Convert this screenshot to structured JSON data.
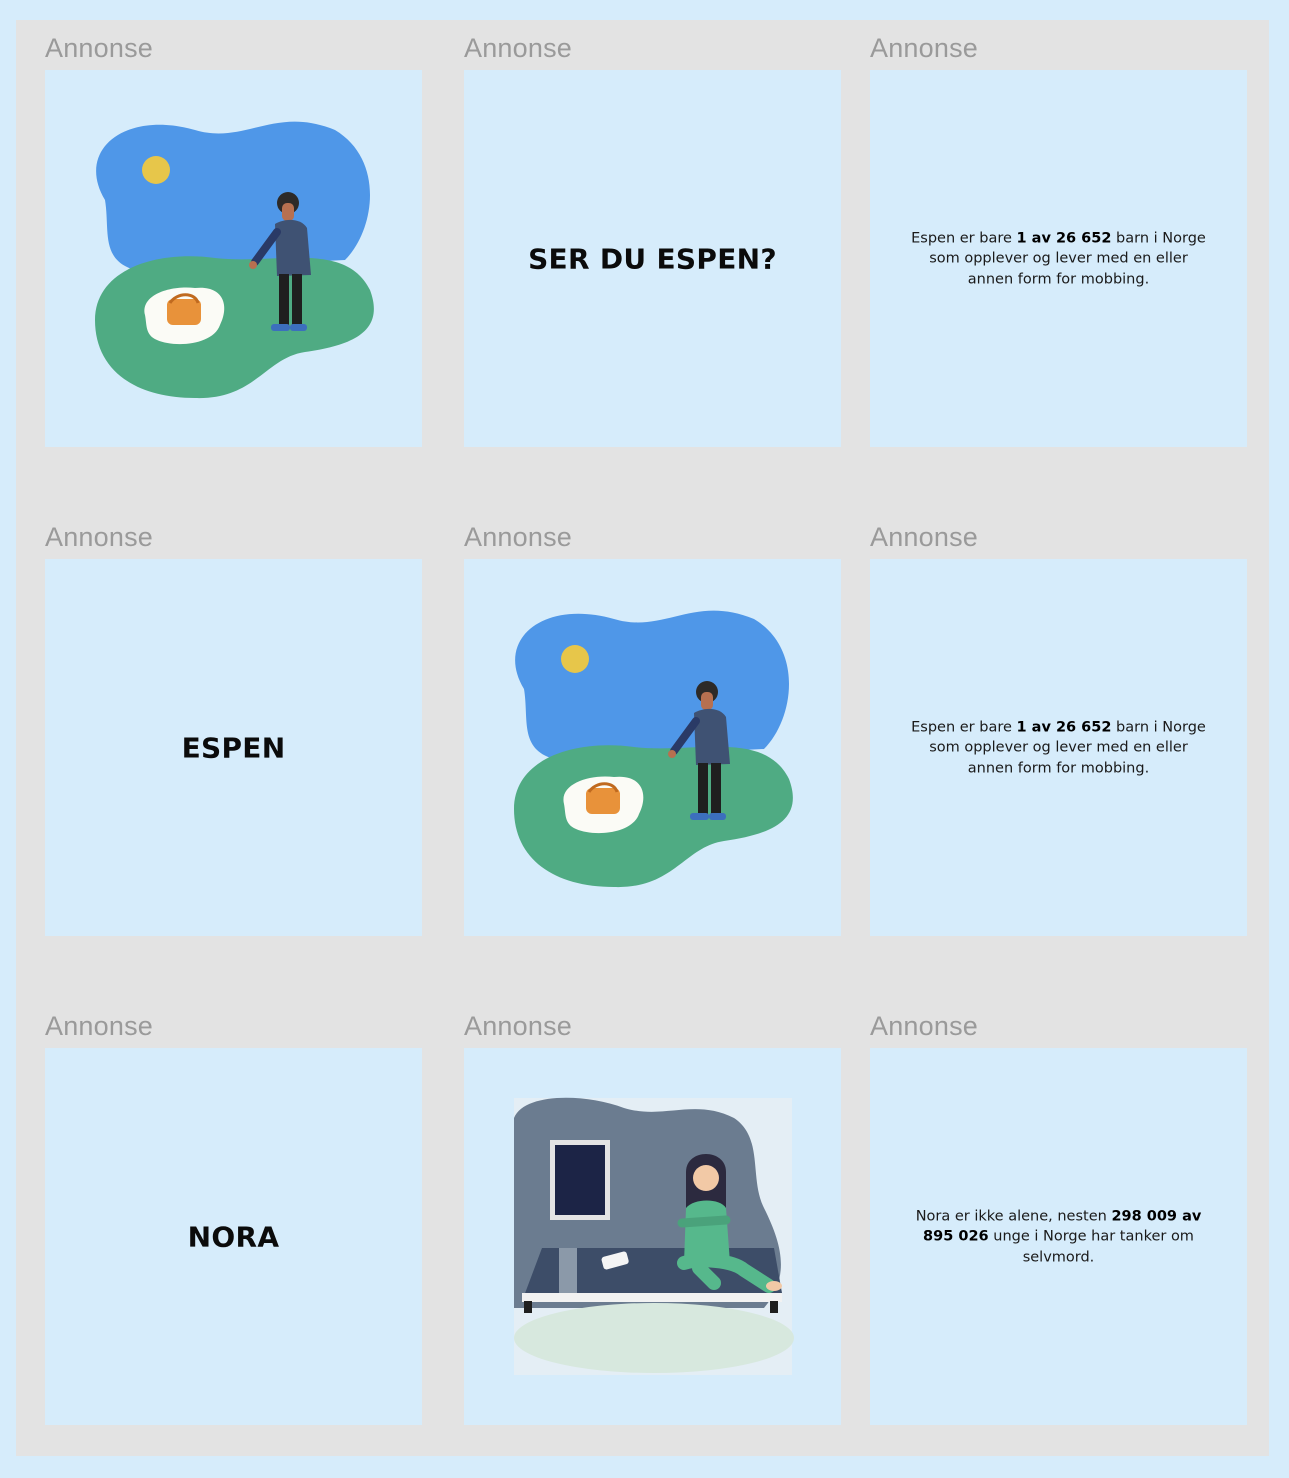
{
  "ad_label": "Annonse",
  "rows": [
    {
      "image_card": {
        "illustration": "boy-in-park-with-bag-illustration"
      },
      "headline_card": {
        "headline": "SER DU ESPEN?"
      },
      "stat_card": {
        "pre": "Espen er bare ",
        "bold": "1 av 26 652",
        "post": " barn i Norge som opplever og lever med en eller annen form for mobbing."
      }
    },
    {
      "headline_card": {
        "headline": "ESPEN"
      },
      "image_card": {
        "illustration": "boy-in-park-with-bag-illustration"
      },
      "stat_card": {
        "pre": "Espen er bare ",
        "bold": "1 av 26 652",
        "post": " barn i Norge som opplever og lever med en eller annen form for mobbing."
      }
    },
    {
      "headline_card": {
        "headline": "NORA"
      },
      "image_card": {
        "illustration": "girl-on-bed-at-night-illustration"
      },
      "stat_card": {
        "pre": "Nora er ikke alene, nesten ",
        "bold": "298 009 av 895 026",
        "post": " unge i Norge har tanker om selvmord."
      }
    }
  ],
  "colors": {
    "page_bg": "#d6ecfb",
    "board_bg": "#e3e3e3",
    "sky": "#4f97e8",
    "grass": "#4fab83",
    "sun": "#e7c64a",
    "room_wall": "#6b7c90",
    "bed": "#3d4d68"
  }
}
